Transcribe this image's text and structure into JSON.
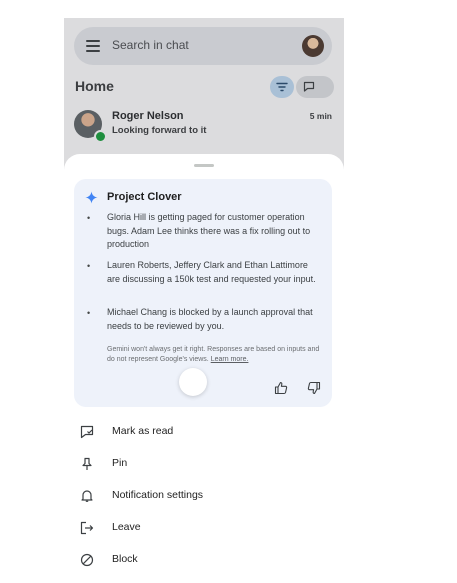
{
  "search": {
    "placeholder": "Search in chat"
  },
  "home": {
    "title": "Home"
  },
  "chat_item": {
    "name": "Roger Nelson",
    "message": "Looking forward to it",
    "time": "5 min"
  },
  "summary_card": {
    "title": "Project Clover",
    "bullets": [
      "Gloria Hill is getting paged for customer operation bugs. Adam Lee thinks there was a fix rolling out to production",
      "Lauren Roberts, Jeffery Clark and Ethan Lattimore are discussing a 150k test and requested your input.",
      "Michael Chang is blocked by a launch approval that needs to be reviewed by you."
    ],
    "disclaimer": "Gemini won't always get it right. Responses are based on inputs and do not represent Google's views.",
    "learn_more": "Learn more."
  },
  "actions": [
    {
      "label": "Mark as read",
      "icon": "mark-read-icon"
    },
    {
      "label": "Pin",
      "icon": "pin-icon"
    },
    {
      "label": "Notification settings",
      "icon": "bell-icon"
    },
    {
      "label": "Leave",
      "icon": "leave-icon"
    },
    {
      "label": "Block",
      "icon": "block-icon"
    }
  ],
  "colors": {
    "accent_spark": "#4285f4",
    "online": "#1e8e3e",
    "card_bg": "#eef2fa"
  }
}
